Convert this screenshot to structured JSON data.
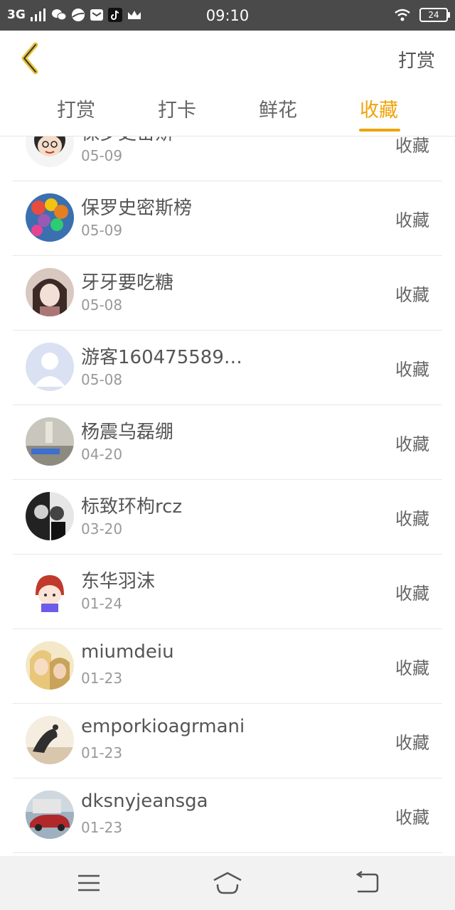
{
  "statusbar": {
    "network": "3G",
    "time": "09:10",
    "battery": "24",
    "icons": [
      "signal-icon",
      "wechat-icon",
      "browser-icon",
      "mail-icon",
      "tiktok-icon",
      "crown-icon",
      "wifi-icon"
    ]
  },
  "header": {
    "action_label": "打赏"
  },
  "tabs": [
    {
      "label": "打赏",
      "active": false
    },
    {
      "label": "打卡",
      "active": false
    },
    {
      "label": "鲜花",
      "active": false
    },
    {
      "label": "收藏",
      "active": true
    }
  ],
  "colors": {
    "accent": "#f0a30a",
    "statusbar": "#4a4a4a",
    "navbar": "#f2f2f2"
  },
  "list": [
    {
      "name": "保罗史密斯",
      "date": "05-09",
      "action": "收藏",
      "avatar": "cartoon-girl-glasses"
    },
    {
      "name": "保罗史密斯榜",
      "date": "05-09",
      "action": "收藏",
      "avatar": "balloons"
    },
    {
      "name": "牙牙要吃糖",
      "date": "05-08",
      "action": "收藏",
      "avatar": "anime-girl"
    },
    {
      "name": "游客160475589…",
      "date": "05-08",
      "action": "收藏",
      "avatar": "default-user"
    },
    {
      "name": "杨震乌磊绷",
      "date": "04-20",
      "action": "收藏",
      "avatar": "room-photo"
    },
    {
      "name": "标致环枸rcz",
      "date": "03-20",
      "action": "收藏",
      "avatar": "bw-couple"
    },
    {
      "name": "东华羽沫",
      "date": "01-24",
      "action": "收藏",
      "avatar": "cute-cartoon"
    },
    {
      "name": "miumdeiu",
      "date": "01-23",
      "action": "收藏",
      "avatar": "anime-blond"
    },
    {
      "name": "emporkioagrmani",
      "date": "01-23",
      "action": "收藏",
      "avatar": "yoga-sunset"
    },
    {
      "name": "dksnyjeansga",
      "date": "01-23",
      "action": "收藏",
      "avatar": "red-car"
    }
  ],
  "navbar": {
    "icons": [
      "menu-icon",
      "home-icon",
      "back-nav-icon"
    ]
  }
}
